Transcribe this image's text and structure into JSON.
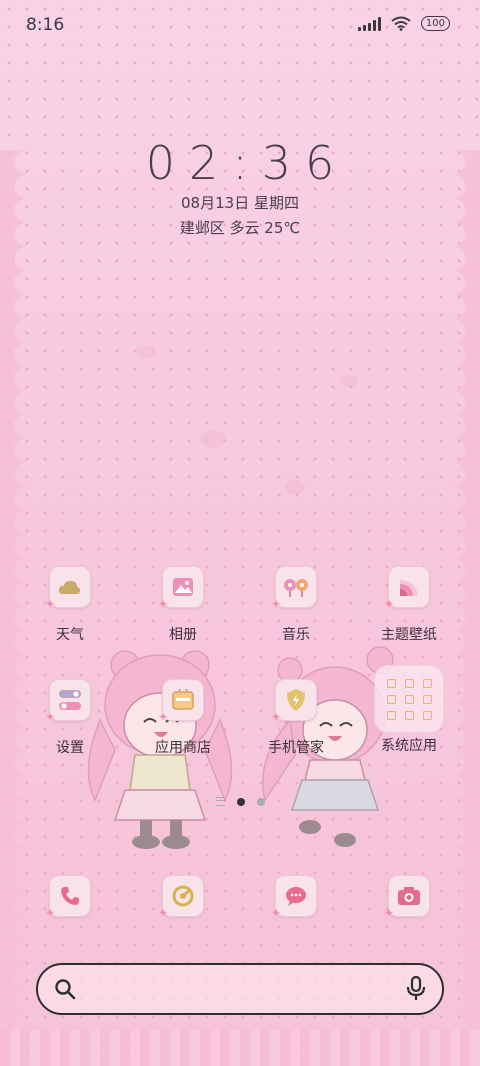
{
  "status_bar": {
    "time": "8:16",
    "battery": "100"
  },
  "clock": {
    "time": "02:36",
    "date": "08月13日 星期四",
    "weather": "建邺区 多云 25℃"
  },
  "apps": [
    {
      "label": "天气",
      "icon": "weather-icon"
    },
    {
      "label": "相册",
      "icon": "gallery-icon"
    },
    {
      "label": "音乐",
      "icon": "music-icon"
    },
    {
      "label": "主题壁纸",
      "icon": "theme-icon"
    },
    {
      "label": "设置",
      "icon": "settings-icon"
    },
    {
      "label": "应用商店",
      "icon": "app-store-icon"
    },
    {
      "label": "手机管家",
      "icon": "security-icon"
    },
    {
      "label": "系统应用",
      "icon": "folder-icon"
    }
  ],
  "pager": {
    "pages": 2,
    "active": 1
  },
  "dock": [
    {
      "icon": "phone-icon"
    },
    {
      "icon": "browser-icon"
    },
    {
      "icon": "messages-icon"
    },
    {
      "icon": "camera-icon"
    }
  ],
  "search": {
    "placeholder": ""
  },
  "colors": {
    "icon_accent": "#f08fb6",
    "icon_tile": "#f8e3ea",
    "text": "#3b3336"
  }
}
